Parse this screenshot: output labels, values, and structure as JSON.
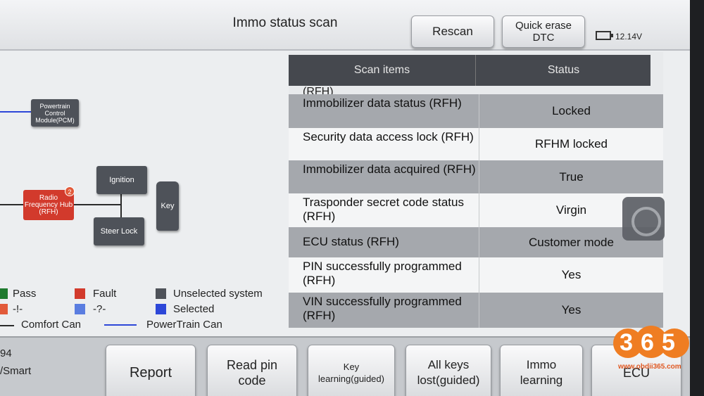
{
  "header": {
    "title": "Immo status scan",
    "rescan_label": "Rescan",
    "quick_erase_line1": "Quick erase",
    "quick_erase_line2": "DTC",
    "battery_voltage": "12.14V"
  },
  "diagram": {
    "nodes": {
      "pcm": "Powertrain Control Module(PCM)",
      "ignition": "Ignition",
      "rfh": "Radio Frequency Hub (RFH)",
      "steer_lock": "Steer Lock",
      "key": "Key"
    },
    "rfh_badge": "2"
  },
  "legend": {
    "pass": "Pass",
    "fault": "Fault",
    "unselected_system": "Unselected system",
    "dash": "-!-",
    "question": "-?-",
    "selected": "Selected",
    "comfort_can": "Comfort Can",
    "powertrain_can": "PowerTrain Can"
  },
  "colors": {
    "pass": "#1e7a2e",
    "fault": "#d23a2c",
    "unselected": "#4e5259",
    "selected": "#2d47d8",
    "warning": "#e25a3a",
    "question": "#5a7de0"
  },
  "table": {
    "header_items": "Scan items",
    "header_status": "Status",
    "partial_top": "(RFH)",
    "rows": [
      {
        "item": "Immobilizer data status (RFH)",
        "status": "Locked"
      },
      {
        "item": "Security data access lock (RFH)",
        "status": "RFHM locked"
      },
      {
        "item": "Immobilizer data acquired (RFH)",
        "status": "True"
      },
      {
        "item": "Trasponder secret code status (RFH)",
        "status": "Virgin"
      },
      {
        "item": "ECU status (RFH)",
        "status": "Customer mode"
      },
      {
        "item": "PIN successfully programmed (RFH)",
        "status": "Yes"
      },
      {
        "item": "VIN successfully programmed (RFH)",
        "status": "Yes"
      }
    ]
  },
  "left_info": {
    "line1": "94",
    "line2": "/Smart"
  },
  "footer": {
    "report": "Report",
    "read_pin_line1": "Read pin",
    "read_pin_line2": "code",
    "key_learning_line1": "Key",
    "key_learning_line2": "learning(guided)",
    "all_keys_line1": "All keys",
    "all_keys_line2": "lost(guided)",
    "immo_learning_line1": "Immo",
    "immo_learning_line2": "learning",
    "ecu": "ECU"
  },
  "watermark": {
    "digits": "365",
    "url": "www.obdii365.com"
  }
}
